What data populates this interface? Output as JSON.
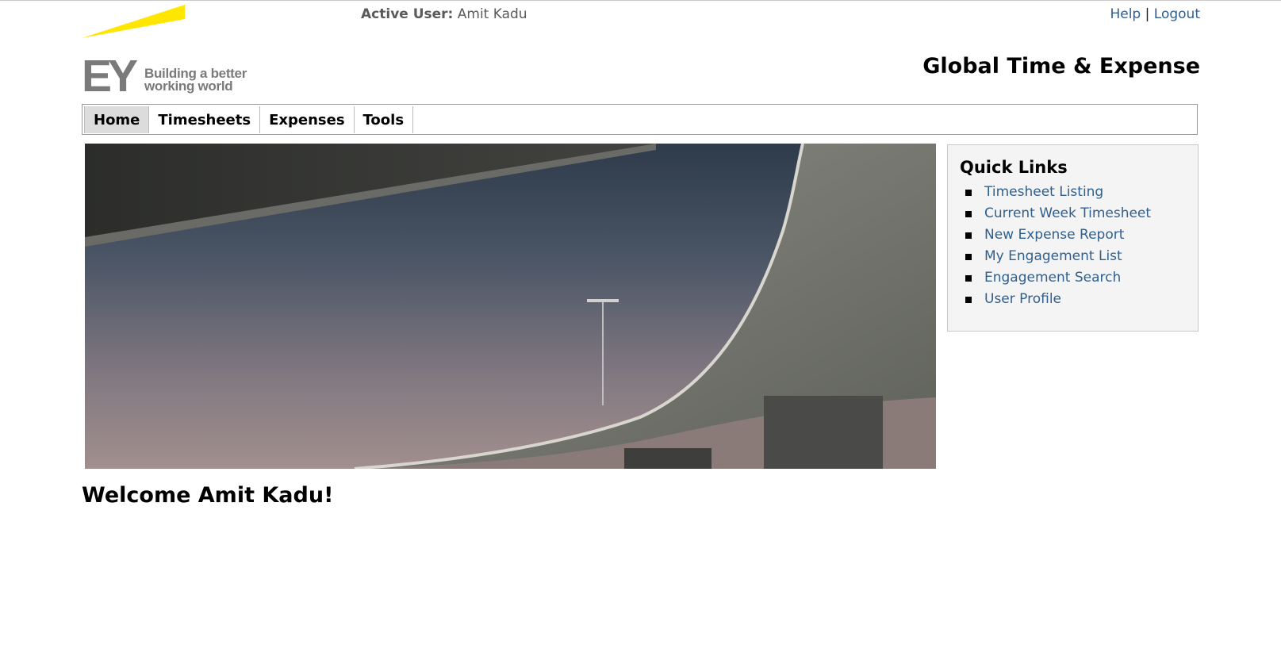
{
  "header": {
    "logo": {
      "mark": "EY",
      "tagline_line1": "Building a better",
      "tagline_line2": "working world",
      "beam_color": "#ffe600"
    },
    "active_user_label": "Active User:",
    "active_user_name": "Amit Kadu",
    "help_label": "Help",
    "separator": "|",
    "logout_label": "Logout",
    "app_title": "Global Time & Expense"
  },
  "nav": {
    "tabs": [
      {
        "label": "Home",
        "active": true
      },
      {
        "label": "Timesheets",
        "active": false
      },
      {
        "label": "Expenses",
        "active": false
      },
      {
        "label": "Tools",
        "active": false
      }
    ]
  },
  "hero": {
    "subject": "curved concrete highway overpass against dusk sky with street lamp"
  },
  "quick_links": {
    "title": "Quick Links",
    "items": [
      {
        "label": "Timesheet Listing"
      },
      {
        "label": "Current Week Timesheet"
      },
      {
        "label": "New Expense Report"
      },
      {
        "label": "My Engagement List"
      },
      {
        "label": "Engagement Search"
      },
      {
        "label": "User Profile"
      }
    ]
  },
  "welcome": "Welcome Amit Kadu!",
  "colors": {
    "link": "#2f5f8f",
    "brand_gray": "#7a7a7a",
    "brand_yellow": "#ffe600"
  }
}
